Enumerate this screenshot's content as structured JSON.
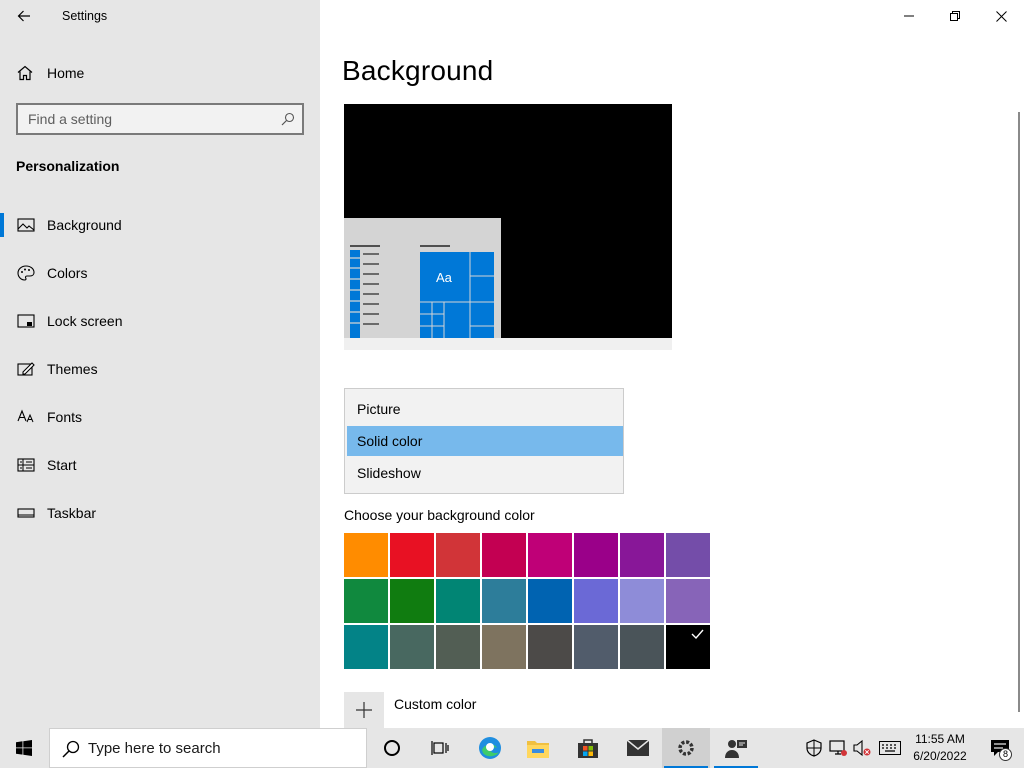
{
  "window": {
    "title": "Settings",
    "back_icon": "back-arrow-icon",
    "controls": {
      "minimize_icon": "minimize-icon",
      "maximize_icon": "restore-icon",
      "close_icon": "close-icon"
    }
  },
  "sidebar": {
    "home_label": "Home",
    "search_placeholder": "Find a setting",
    "section_title": "Personalization",
    "items": [
      {
        "label": "Background",
        "icon": "picture-icon",
        "active": true
      },
      {
        "label": "Colors",
        "icon": "palette-icon",
        "active": false
      },
      {
        "label": "Lock screen",
        "icon": "lock-screen-icon",
        "active": false
      },
      {
        "label": "Themes",
        "icon": "themes-icon",
        "active": false
      },
      {
        "label": "Fonts",
        "icon": "fonts-icon",
        "active": false
      },
      {
        "label": "Start",
        "icon": "start-icon",
        "active": false
      },
      {
        "label": "Taskbar",
        "icon": "taskbar-icon",
        "active": false
      }
    ]
  },
  "main": {
    "title": "Background",
    "preview": {
      "tile_text": "Aa",
      "background_color": "#000000",
      "accent": "#0078d7"
    },
    "background_dropdown": {
      "options": [
        "Picture",
        "Solid color",
        "Slideshow"
      ],
      "selected": "Solid color"
    },
    "choose_color_label": "Choose your background color",
    "colors": [
      [
        "#ff8c00",
        "#e81123",
        "#d13438",
        "#c30052",
        "#bf0077",
        "#9a0089",
        "#881798",
        "#744da9"
      ],
      [
        "#10893e",
        "#107c10",
        "#018574",
        "#2d7d9a",
        "#0063b1",
        "#6b69d6",
        "#8e8cd8",
        "#8764b8"
      ],
      [
        "#038387",
        "#486860",
        "#525e54",
        "#7e735f",
        "#4c4a48",
        "#515c6b",
        "#4a5459",
        "#000000"
      ]
    ],
    "selected_color": "#000000",
    "custom_color_label": "Custom color"
  },
  "taskbar": {
    "search_placeholder": "Type here to search",
    "apps": [
      "cortana-icon",
      "task-view-icon",
      "edge-icon",
      "file-explorer-icon",
      "store-icon",
      "mail-icon",
      "settings-icon",
      "people-icon"
    ],
    "tray": [
      "security-icon",
      "network-icon",
      "volume-muted-icon",
      "keyboard-icon"
    ],
    "time": "11:55 AM",
    "date": "6/20/2022",
    "notification_count": "8"
  }
}
